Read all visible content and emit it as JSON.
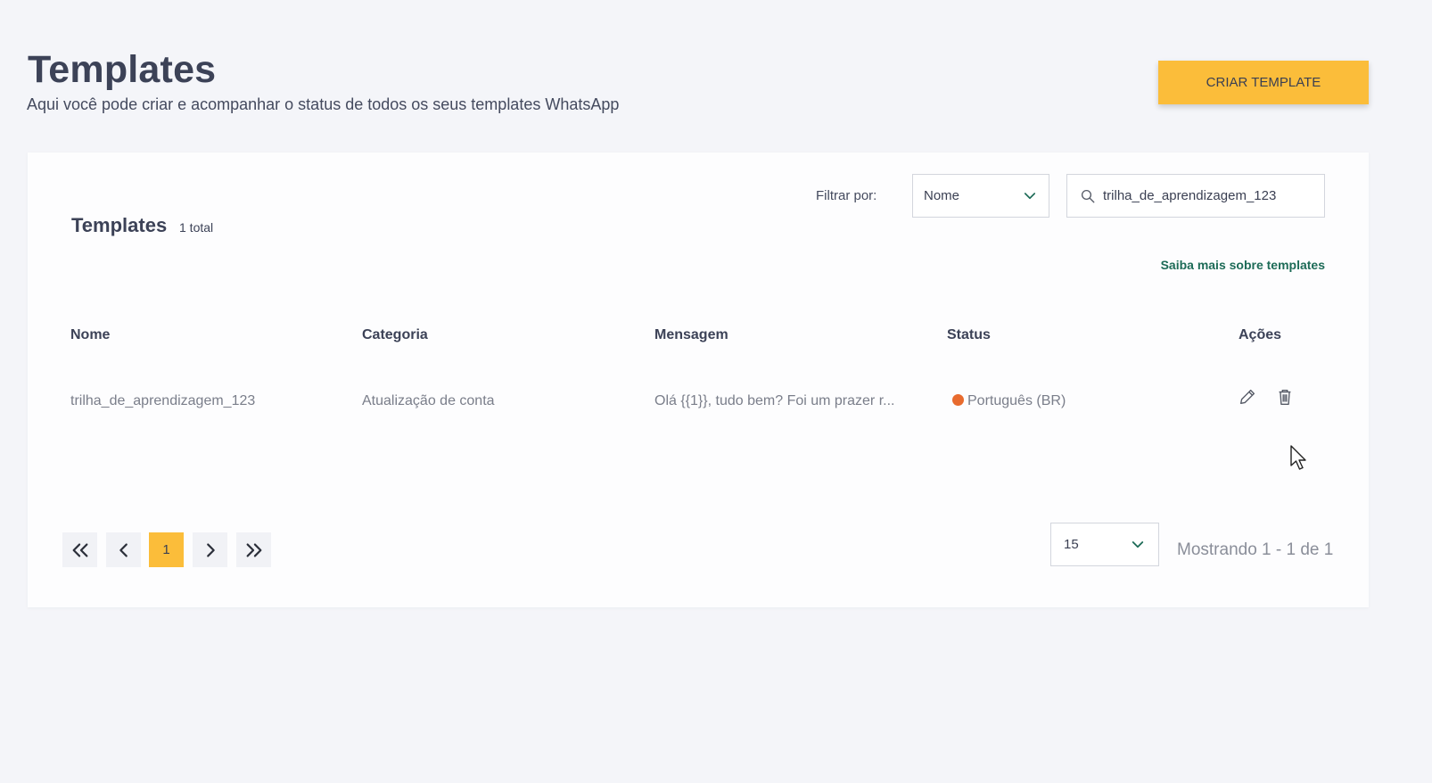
{
  "header": {
    "title": "Templates",
    "subtitle": "Aqui você pode criar e acompanhar o status de todos os seus templates WhatsApp",
    "create_button": "CRIAR TEMPLATE"
  },
  "card": {
    "title": "Templates",
    "count": "1 total",
    "filter_label": "Filtrar por:",
    "filter_value": "Nome",
    "search_value": "trilha_de_aprendizagem_123",
    "learn_more": "Saiba mais sobre templates"
  },
  "table": {
    "columns": [
      "Nome",
      "Categoria",
      "Mensagem",
      "Status",
      "Ações"
    ],
    "rows": [
      {
        "nome": "trilha_de_aprendizagem_123",
        "categoria": "Atualização de conta",
        "mensagem": "Olá {{1}}, tudo bem? Foi um prazer r...",
        "status": "Português (BR)",
        "status_color": "#e86b2e"
      }
    ]
  },
  "pagination": {
    "current_page": "1",
    "page_size": "15",
    "showing": "Mostrando 1 - 1 de 1"
  },
  "colors": {
    "accent": "#fbbd3a",
    "link": "#1d6b57",
    "chevron": "#1d6b57"
  },
  "icons": [
    "chevron-down-icon",
    "search-icon",
    "pencil-icon",
    "trash-icon",
    "double-chevron-left-icon",
    "chevron-left-icon",
    "chevron-right-icon",
    "double-chevron-right-icon",
    "mouse-cursor-icon"
  ]
}
